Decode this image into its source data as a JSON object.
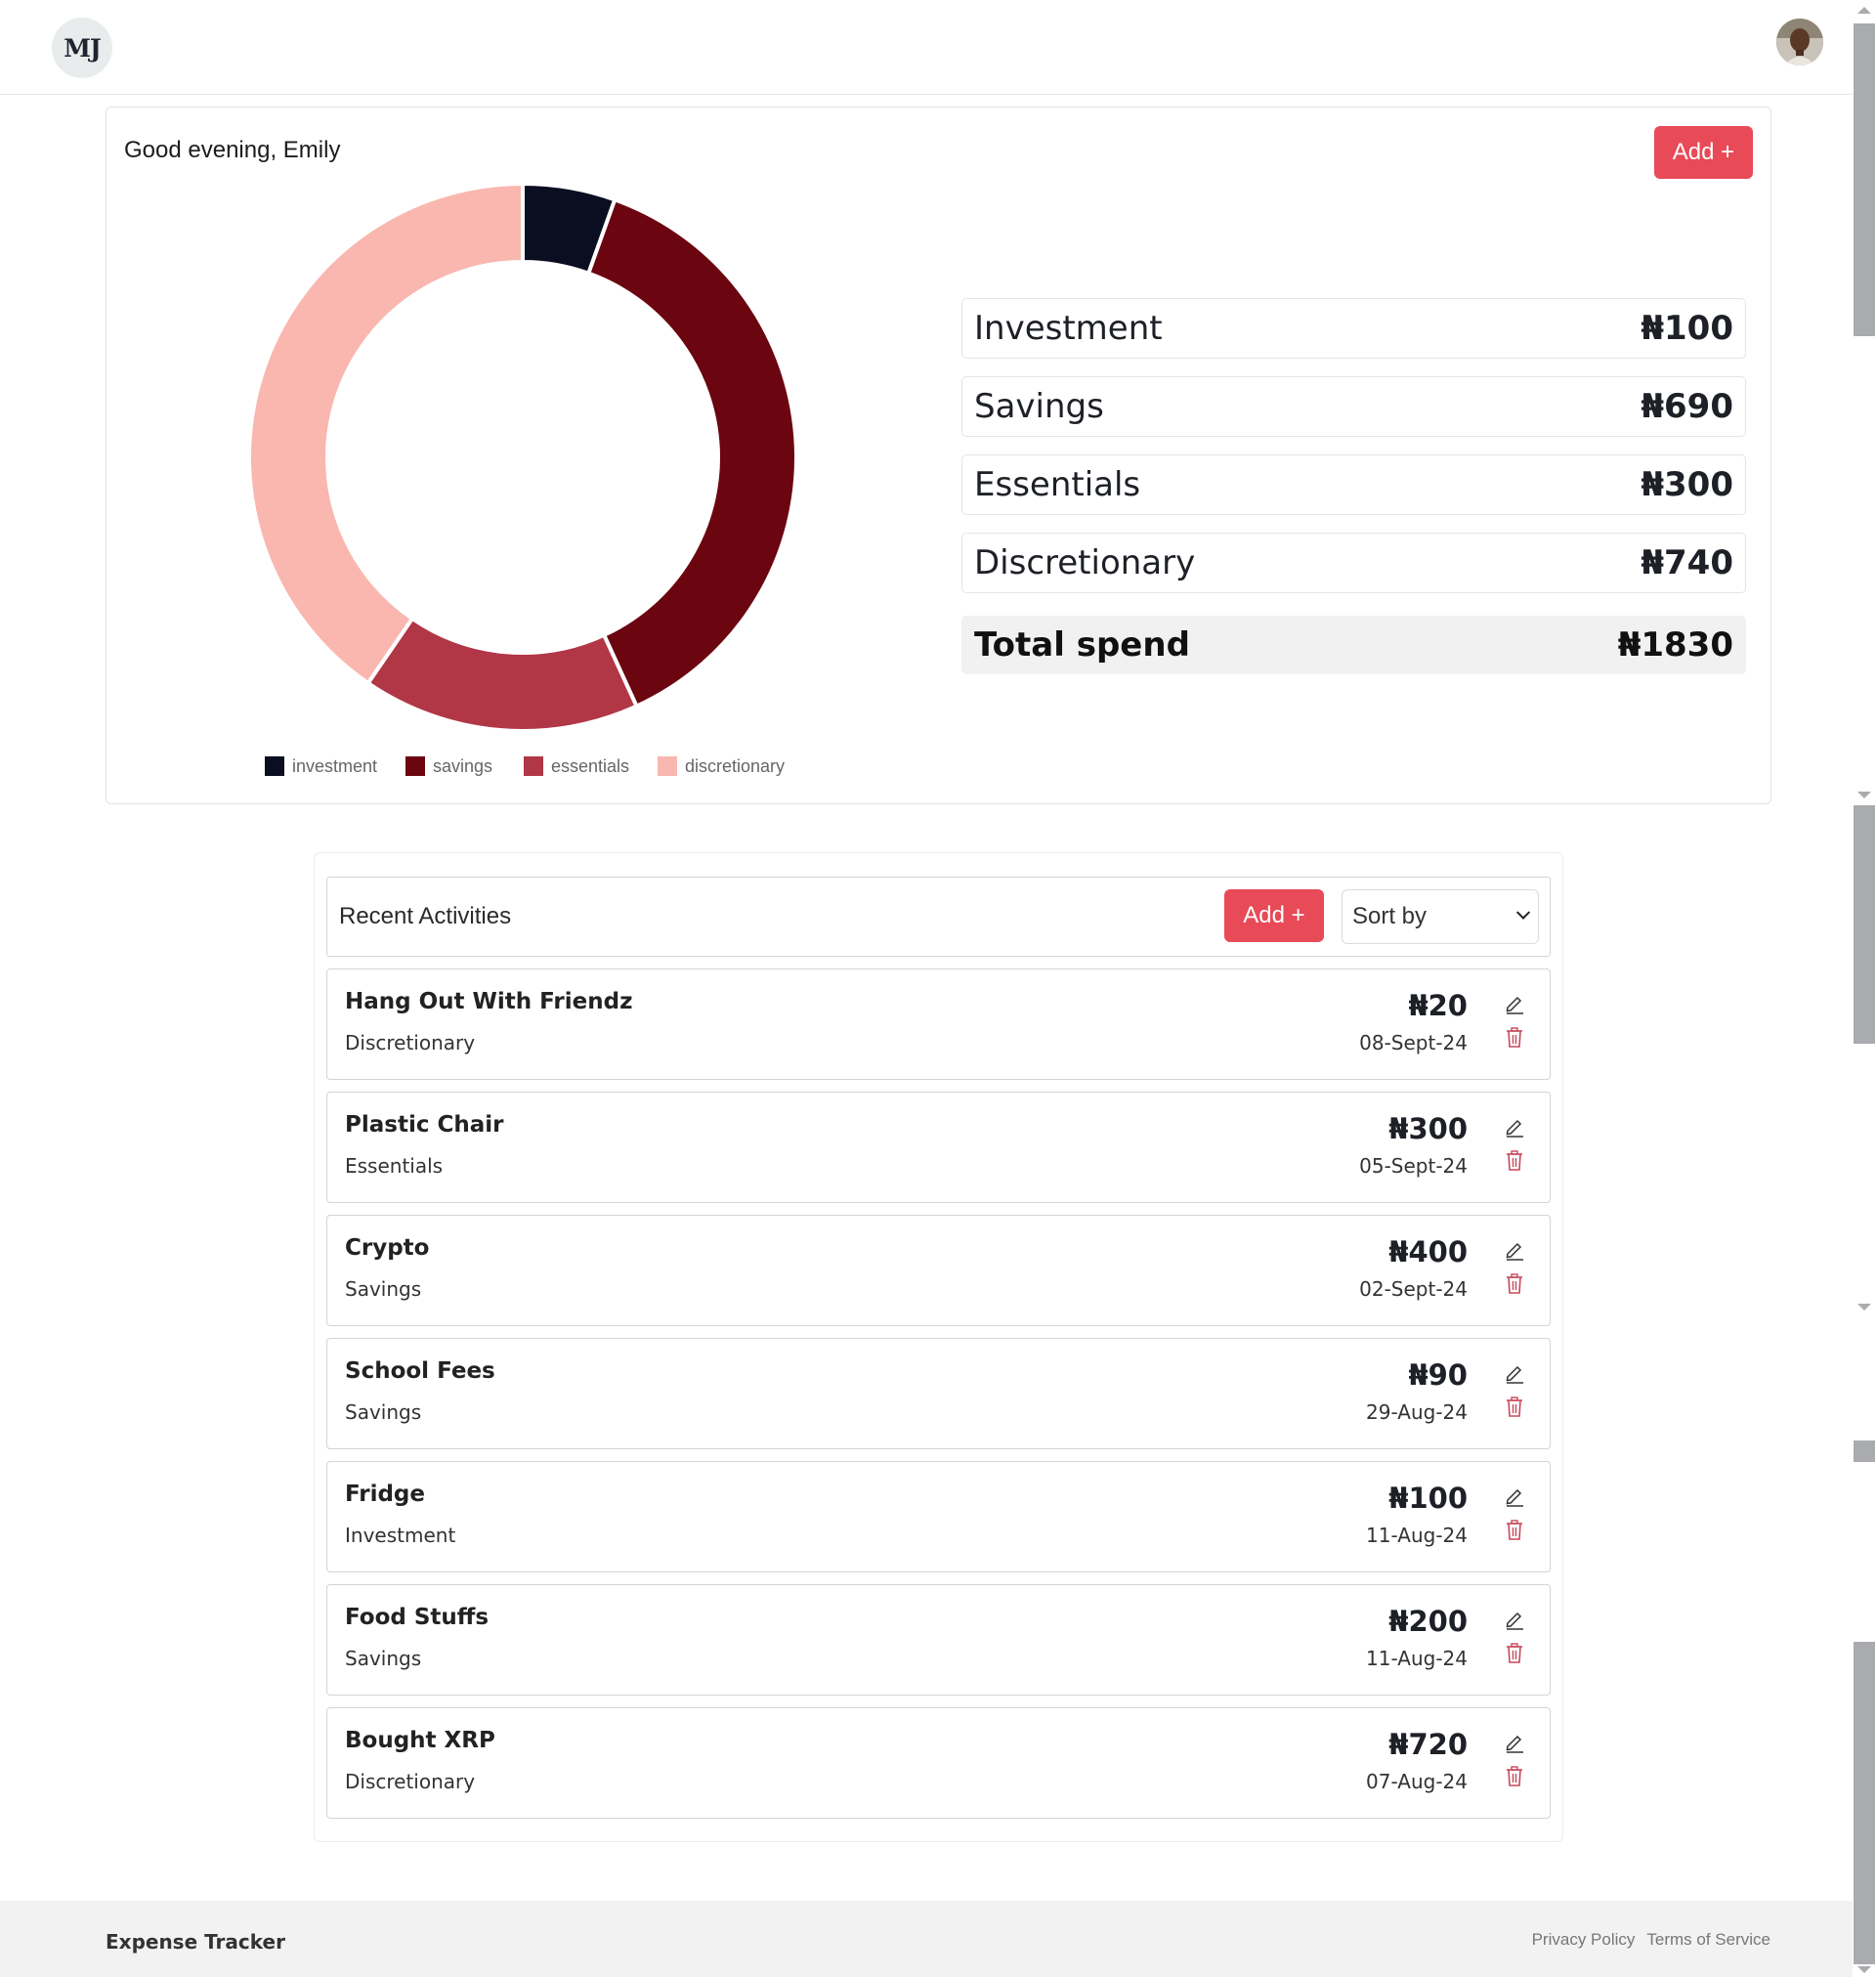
{
  "header": {
    "logo_text": "MJ",
    "avatar": "user-avatar"
  },
  "summary": {
    "greeting": "Good evening, Emily",
    "add_label": "Add +",
    "categories": [
      {
        "label": "Investment",
        "amount": "₦100"
      },
      {
        "label": "Savings",
        "amount": "₦690"
      },
      {
        "label": "Essentials",
        "amount": "₦300"
      },
      {
        "label": "Discretionary",
        "amount": "₦740"
      }
    ],
    "total": {
      "label": "Total spend",
      "amount": "₦1830"
    }
  },
  "chart_data": {
    "type": "pie",
    "variant": "doughnut",
    "categories": [
      "investment",
      "savings",
      "essentials",
      "discretionary"
    ],
    "values": [
      100,
      690,
      300,
      740
    ],
    "colors": [
      "#0b0d21",
      "#6b0510",
      "#b13646",
      "#f9b7b0"
    ],
    "legend_position": "bottom"
  },
  "activities": {
    "title": "Recent Activities",
    "add_label": "Add +",
    "sort_label": "Sort by",
    "items": [
      {
        "title": "Hang Out With Friendz",
        "category": "Discretionary",
        "amount": "₦20",
        "date": "08-Sept-24"
      },
      {
        "title": "Plastic Chair",
        "category": "Essentials",
        "amount": "₦300",
        "date": "05-Sept-24"
      },
      {
        "title": "Crypto",
        "category": "Savings",
        "amount": "₦400",
        "date": "02-Sept-24"
      },
      {
        "title": "School Fees",
        "category": "Savings",
        "amount": "₦90",
        "date": "29-Aug-24"
      },
      {
        "title": "Fridge",
        "category": "Investment",
        "amount": "₦100",
        "date": "11-Aug-24"
      },
      {
        "title": "Food Stuffs",
        "category": "Savings",
        "amount": "₦200",
        "date": "11-Aug-24"
      },
      {
        "title": "Bought XRP",
        "category": "Discretionary",
        "amount": "₦720",
        "date": "07-Aug-24"
      }
    ],
    "edit_icon": "pencil-icon",
    "delete_icon": "trash-icon"
  },
  "footer": {
    "brand": "Expense Tracker",
    "links": [
      "Privacy Policy",
      "Terms of Service"
    ]
  },
  "colors": {
    "accent": "#e84a57",
    "delete_icon": "#c8485a"
  }
}
